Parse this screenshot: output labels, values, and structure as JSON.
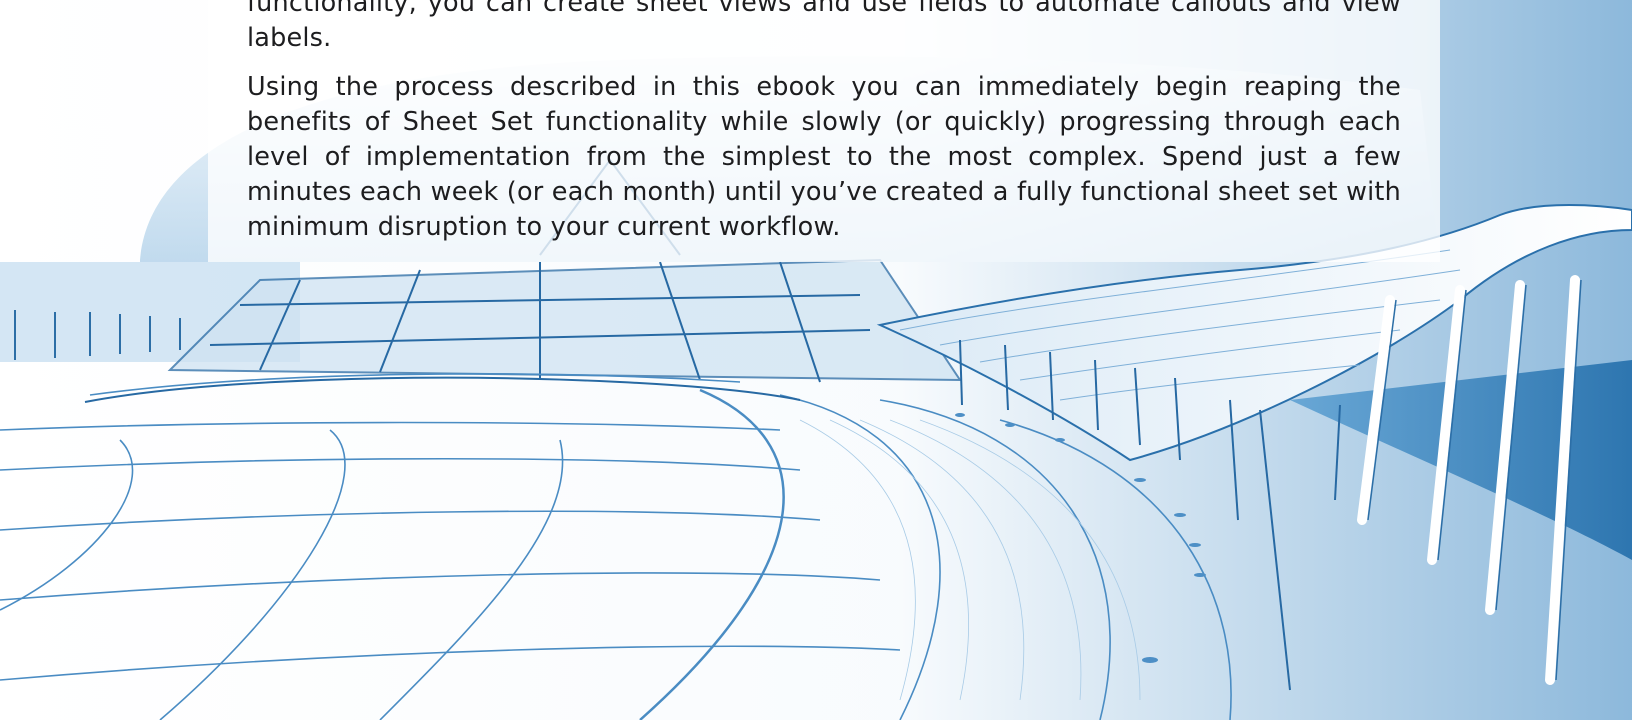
{
  "document": {
    "paragraphs": [
      "functionality, you can create sheet views and use fields to automate callouts and view labels.",
      "Using the process described in this ebook you can immediately begin reaping the benefits of Sheet Set functionality while slowly (or quickly) progressing through each level of implementation from the simplest to the most complex. Spend just a few minutes each week (or each month) until you’ve created a fully functional sheet set with minimum disruption to your current workflow."
    ]
  },
  "colors": {
    "background": "#ffffff",
    "text": "#1d1d1f",
    "illustration_blue": "#2d7fbf",
    "illustration_light_blue": "#a9cfe9"
  }
}
